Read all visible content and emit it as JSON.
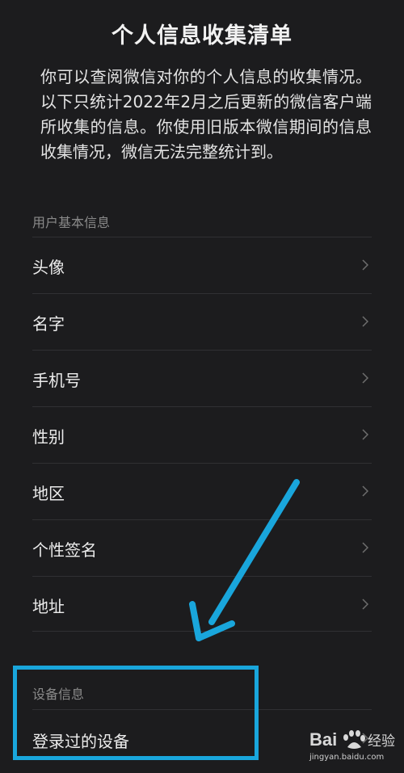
{
  "header": {
    "title": "个人信息收集清单",
    "description": "你可以查阅微信对你的个人信息的收集情况。以下只统计2022年2月之后更新的微信客户端所收集的信息。你使用旧版本微信期间的信息收集情况，微信无法完整统计到。"
  },
  "sections": [
    {
      "label": "用户基本信息",
      "items": [
        {
          "label": "头像"
        },
        {
          "label": "名字"
        },
        {
          "label": "手机号"
        },
        {
          "label": "性别"
        },
        {
          "label": "地区"
        },
        {
          "label": "个性签名"
        },
        {
          "label": "地址"
        }
      ]
    },
    {
      "label": "设备信息",
      "items": [
        {
          "label": "登录过的设备"
        }
      ]
    }
  ],
  "icons": {
    "row_chevron": "chevron-right-icon",
    "annotation": "arrow-down-left-icon"
  },
  "colors": {
    "background": "#1c1c1e",
    "text": "#ececec",
    "section_label": "#8a8a8a",
    "divider": "#303033",
    "annotation": "#19a6dc"
  },
  "watermark": {
    "logo_text": "Bai经验",
    "url": "jingyan.baidu.com"
  }
}
